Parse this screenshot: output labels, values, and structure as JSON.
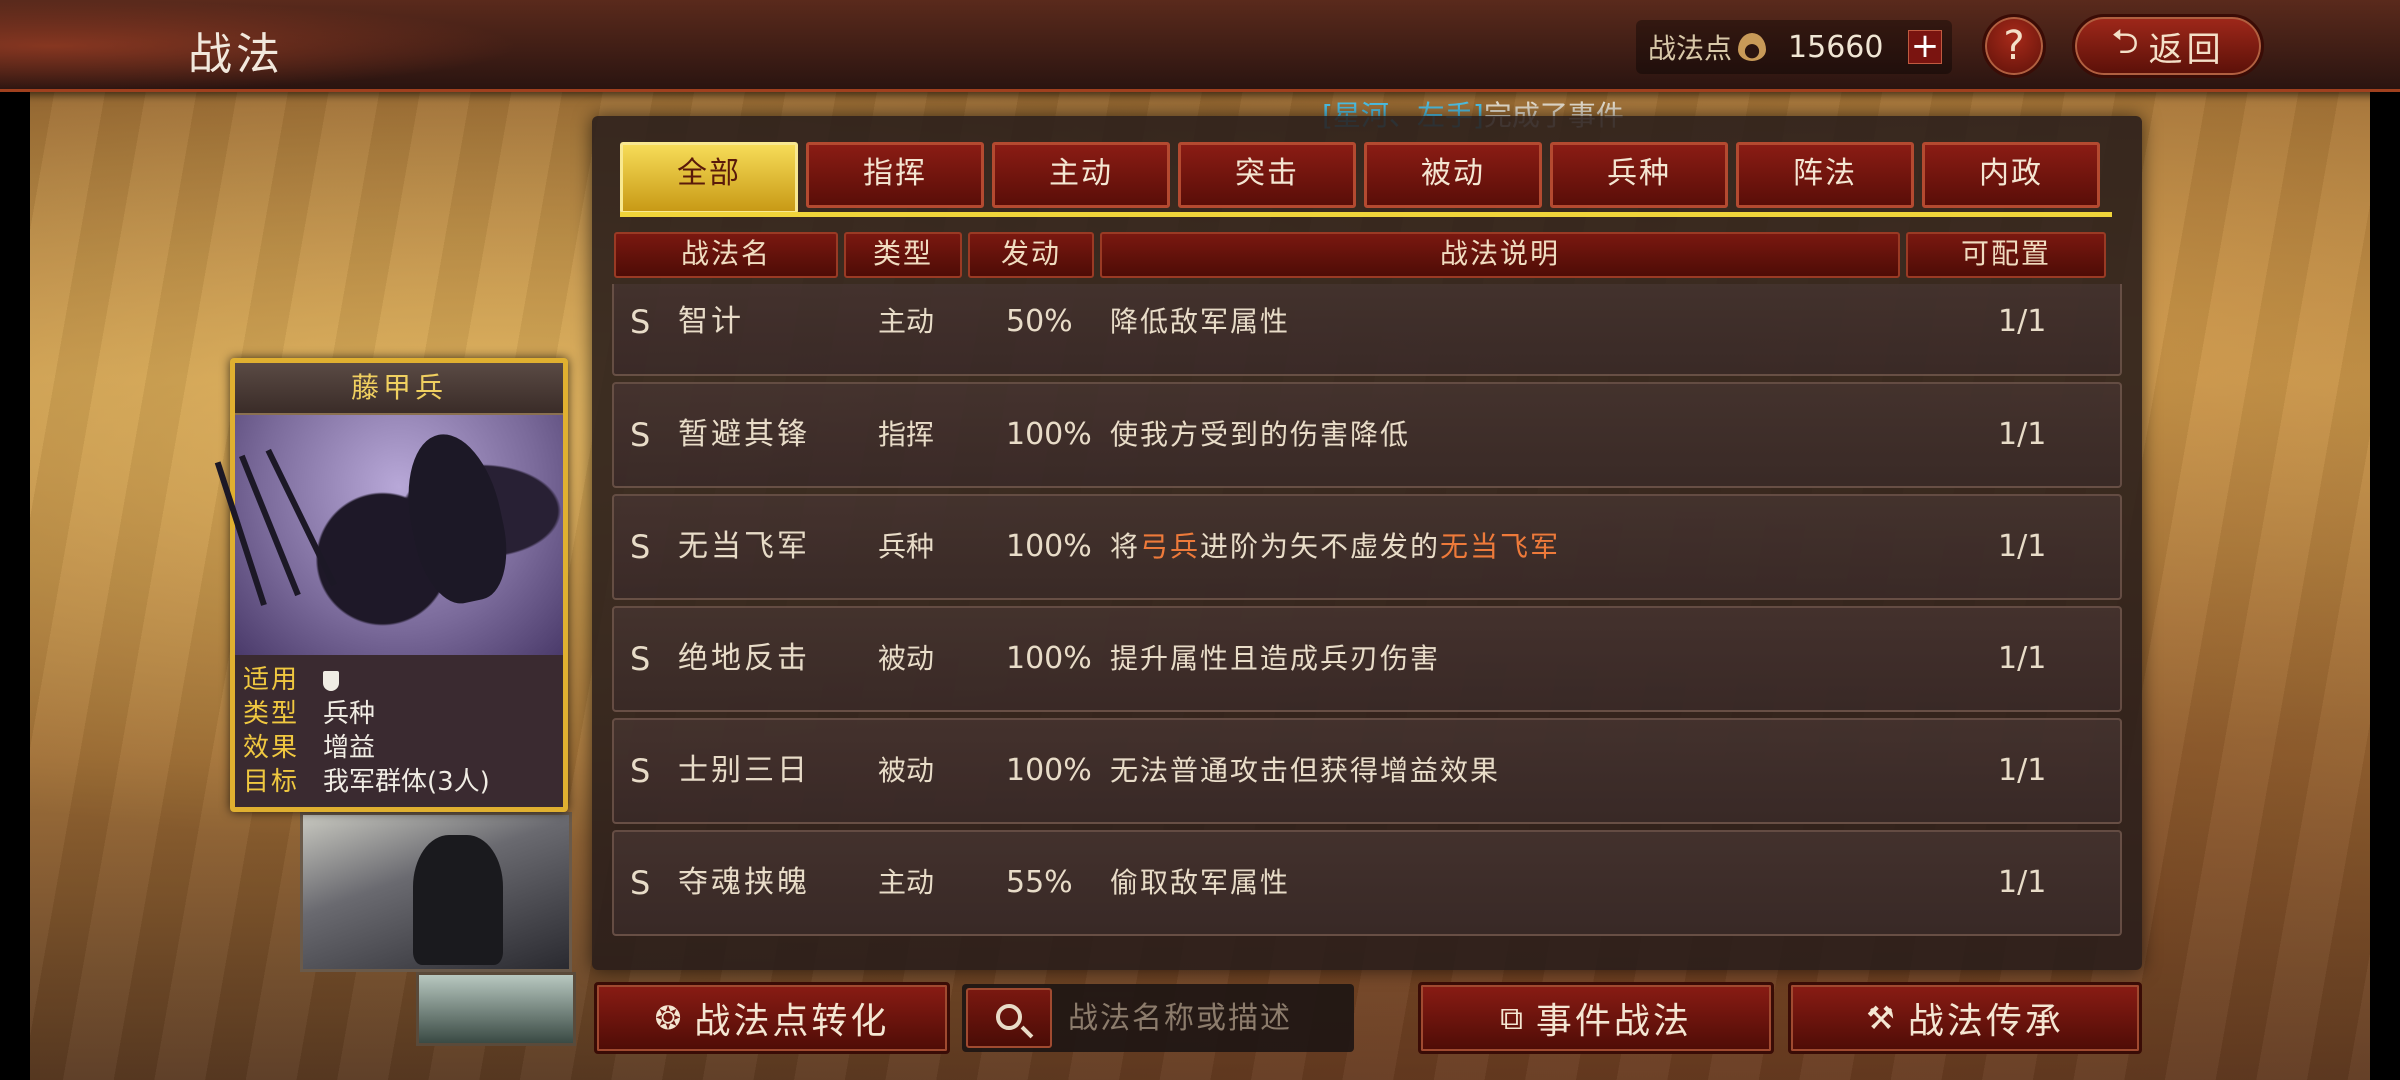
{
  "header": {
    "title": "战法",
    "points_label": "战法点",
    "points_value": "15660",
    "plus_label": "+",
    "help_label": "?",
    "back_label": "返回"
  },
  "marquee": {
    "highlight": "[星河、左手]",
    "text": "完成了事件"
  },
  "tabs": [
    {
      "label": "全部",
      "active": true
    },
    {
      "label": "指挥"
    },
    {
      "label": "主动"
    },
    {
      "label": "突击"
    },
    {
      "label": "被动"
    },
    {
      "label": "兵种"
    },
    {
      "label": "阵法"
    },
    {
      "label": "内政"
    }
  ],
  "table": {
    "headers": [
      "战法名",
      "类型",
      "发动",
      "战法说明",
      "可配置"
    ],
    "rows": [
      {
        "rank": "S",
        "name": "智计",
        "type": "主动",
        "rate": "50%",
        "desc": "降低敌军属性",
        "cfg": "1/1"
      },
      {
        "rank": "S",
        "name": "暂避其锋",
        "type": "指挥",
        "rate": "100%",
        "desc": "使我方受到的伤害降低",
        "cfg": "1/1"
      },
      {
        "rank": "S",
        "name": "无当飞军",
        "type": "兵种",
        "rate": "100%",
        "desc_parts": [
          "将",
          "弓兵",
          "进阶为矢不虚发的",
          "无当飞军"
        ],
        "cfg": "1/1"
      },
      {
        "rank": "S",
        "name": "绝地反击",
        "type": "被动",
        "rate": "100%",
        "desc": "提升属性且造成兵刃伤害",
        "cfg": "1/1"
      },
      {
        "rank": "S",
        "name": "士别三日",
        "type": "被动",
        "rate": "100%",
        "desc": "无法普通攻击但获得增益效果",
        "cfg": "1/1"
      },
      {
        "rank": "S",
        "name": "夺魂挟魄",
        "type": "主动",
        "rate": "55%",
        "desc": "偷取敌军属性",
        "cfg": "1/1"
      }
    ]
  },
  "unit_card": {
    "title": "藤甲兵",
    "fields": [
      {
        "key": "适用",
        "value": ""
      },
      {
        "key": "类型",
        "value": "兵种"
      },
      {
        "key": "效果",
        "value": "增益"
      },
      {
        "key": "目标",
        "value": "我军群体(3人)"
      }
    ]
  },
  "bottom": {
    "convert_label": "战法点转化",
    "search_placeholder": "战法名称或描述",
    "event_label": "事件战法",
    "inherit_label": "战法传承"
  },
  "colors": {
    "accent_gold": "#f0d43a",
    "tab_red": "#8a1c14",
    "highlight_orange": "#ee7a3a",
    "marquee_blue": "#4fc3e8"
  }
}
